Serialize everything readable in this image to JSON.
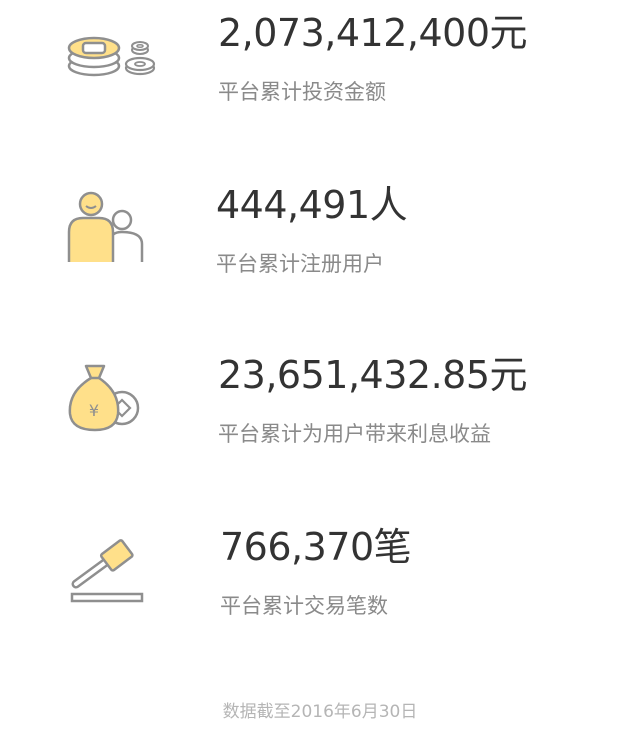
{
  "stats": [
    {
      "value": "2,073,412,400元",
      "label": "平台累计投资金额",
      "icon": "coins-icon"
    },
    {
      "value": "444,491人",
      "label": "平台累计注册用户",
      "icon": "users-icon"
    },
    {
      "value": "23,651,432.85元",
      "label": "平台累计为用户带来利息收益",
      "icon": "money-bag-icon"
    },
    {
      "value": "766,370笔",
      "label": "平台累计交易笔数",
      "icon": "gavel-icon"
    }
  ],
  "footer": {
    "note": "数据截至2016年6月30日"
  },
  "colors": {
    "accent": "#FFE08A",
    "icon_stroke": "#8F8F8F",
    "value_text": "#333333",
    "label_text": "#8A8A8A",
    "footer_text": "#B5B5B5"
  }
}
